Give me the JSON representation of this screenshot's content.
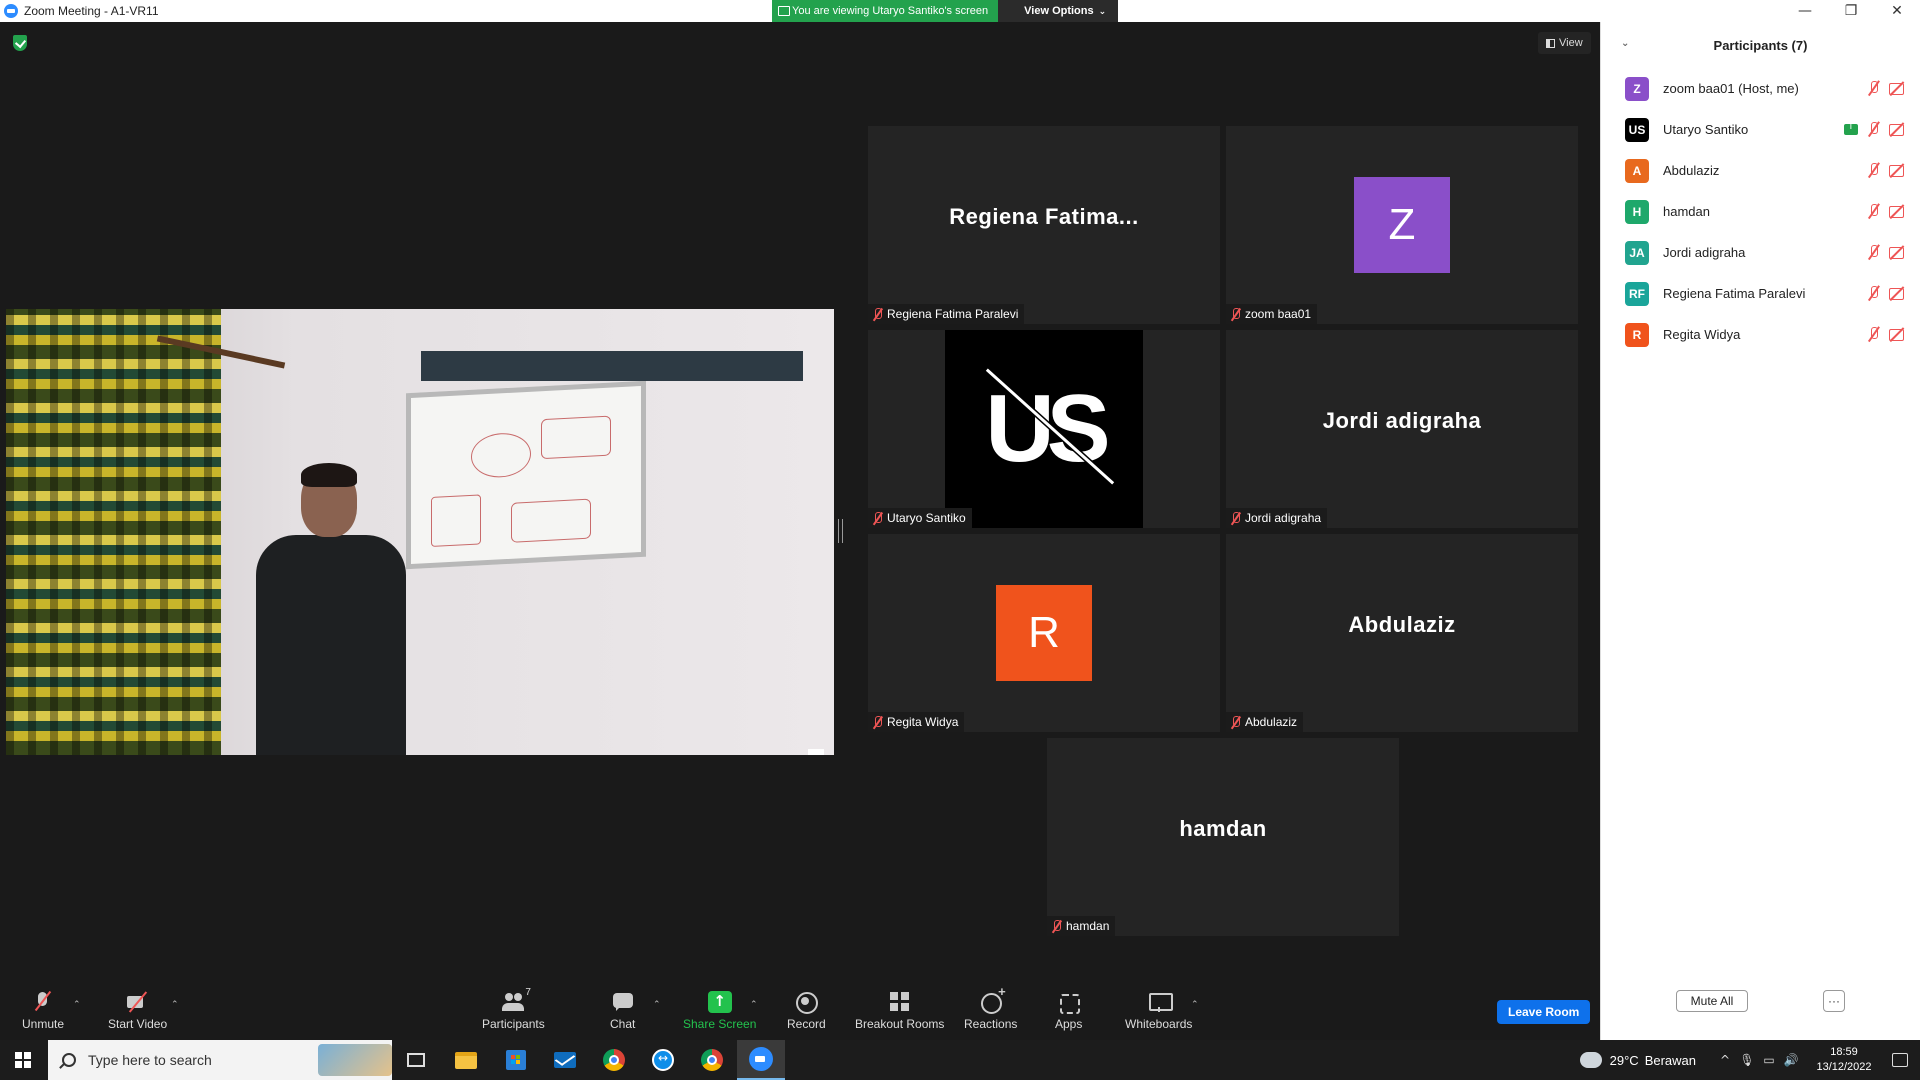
{
  "window": {
    "title": "Zoom Meeting - A1-VR11",
    "controls": {
      "minimize": "—",
      "restore": "❐",
      "close": "✕"
    }
  },
  "banner": {
    "viewing_text": "You are viewing Utaryo Santiko's screen",
    "view_options": "View Options",
    "view_options_chevron": "⌄"
  },
  "view_button": "View",
  "tiles": [
    {
      "display": "Regiena  Fatima...",
      "label": "Regiena Fatima Paralevi",
      "kind": "name"
    },
    {
      "display": "Z",
      "label": "zoom baa01",
      "kind": "avatar",
      "color": "#8a4fc9"
    },
    {
      "display": "US",
      "label": "Utaryo Santiko",
      "kind": "logo"
    },
    {
      "display": "Jordi adigraha",
      "label": "Jordi adigraha",
      "kind": "name"
    },
    {
      "display": "R",
      "label": "Regita Widya",
      "kind": "avatar",
      "color": "#f0531c"
    },
    {
      "display": "Abdulaziz",
      "label": "Abdulaziz",
      "kind": "name"
    },
    {
      "display": "hamdan",
      "label": "hamdan",
      "kind": "name"
    }
  ],
  "toolbar": {
    "unmute": "Unmute",
    "start_video": "Start Video",
    "participants": "Participants",
    "participants_count": "7",
    "chat": "Chat",
    "share_screen": "Share Screen",
    "record": "Record",
    "breakout_rooms": "Breakout Rooms",
    "reactions": "Reactions",
    "apps": "Apps",
    "whiteboards": "Whiteboards",
    "leave_room": "Leave Room",
    "caret": "⌃"
  },
  "panel": {
    "title": "Participants (7)",
    "collapse_glyph": "⌄",
    "participants": [
      {
        "initials": "Z",
        "name": "zoom baa01 (Host, me)",
        "color": "#8a4fc9",
        "sharing": false
      },
      {
        "initials": "US",
        "name": "Utaryo Santiko",
        "color": "#000000",
        "sharing": true
      },
      {
        "initials": "A",
        "name": "Abdulaziz",
        "color": "#e8691e",
        "sharing": false
      },
      {
        "initials": "H",
        "name": "hamdan",
        "color": "#1ea86b",
        "sharing": false
      },
      {
        "initials": "JA",
        "name": "Jordi adigraha",
        "color": "#21a48f",
        "sharing": false
      },
      {
        "initials": "RF",
        "name": "Regiena Fatima Paralevi",
        "color": "#1aa59a",
        "sharing": false
      },
      {
        "initials": "R",
        "name": "Regita Widya",
        "color": "#f0531c",
        "sharing": false
      }
    ],
    "mute_all": "Mute All",
    "more": "···"
  },
  "taskbar": {
    "search_placeholder": "Type here to search",
    "weather_temp": "29°C",
    "weather_desc": "Berawan",
    "tray_chevron": "^",
    "time": "18:59",
    "date": "13/12/2022"
  }
}
